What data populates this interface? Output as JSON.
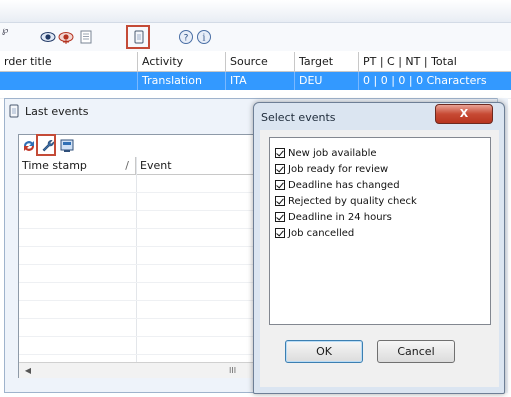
{
  "main_grid": {
    "columns": [
      "rder title",
      "Activity",
      "Source",
      "Target",
      "PT | C | NT | Total"
    ],
    "selected_row": {
      "order_title": "",
      "activity": "Translation",
      "source": "ITA",
      "target": "DEU",
      "counts": "0 | 0 | 0 | 0 Characters"
    }
  },
  "last_events_panel": {
    "title": "Last events",
    "columns": [
      "Time stamp",
      "Event"
    ],
    "hscroll_glyph": "III"
  },
  "select_events_dialog": {
    "title": "Select events",
    "close_label": "X",
    "options": [
      {
        "label": "New job available",
        "checked": true
      },
      {
        "label": "Job ready for review",
        "checked": true
      },
      {
        "label": "Deadline has changed",
        "checked": true
      },
      {
        "label": "Rejected by quality check",
        "checked": true
      },
      {
        "label": "Deadline in 24 hours",
        "checked": true
      },
      {
        "label": "Job cancelled",
        "checked": true
      }
    ],
    "ok_label": "OK",
    "cancel_label": "Cancel"
  },
  "colors": {
    "selection": "#3399ff",
    "highlight_box": "#c44b37",
    "close_button": "#c74a34"
  }
}
